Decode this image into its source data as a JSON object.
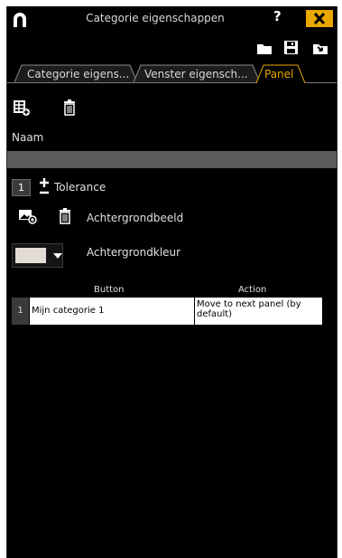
{
  "window": {
    "title": "Categorie eigenschappen",
    "help_label": "?",
    "close_label": "X"
  },
  "tabs": [
    {
      "label": "Categorie eigens..."
    },
    {
      "label": "Venster eigensch..."
    },
    {
      "label": "Panel",
      "active": true
    }
  ],
  "colors": {
    "accent": "#e9a800",
    "background": "#000000",
    "name_field": "#5c5c5c",
    "background_color_swatch": "#e3dcd5"
  },
  "icons": {
    "toolbar_top": [
      "folder-icon",
      "save-icon",
      "import-icon"
    ],
    "row_actions": [
      "add-table-icon",
      "trash-icon"
    ],
    "background_image": [
      "image-add-icon",
      "trash-icon"
    ]
  },
  "form": {
    "name_label": "Naam",
    "name_value": "",
    "tolerance_value": "1",
    "tolerance_label": "Tolerance",
    "background_image_label": "Achtergrondbeeld",
    "background_color_label": "Achtergrondkleur"
  },
  "table": {
    "columns": [
      "Button",
      "Action"
    ],
    "rows": [
      {
        "index": "1",
        "button": "Mijn categorie 1",
        "action": "Move to next panel (by default)"
      }
    ]
  }
}
